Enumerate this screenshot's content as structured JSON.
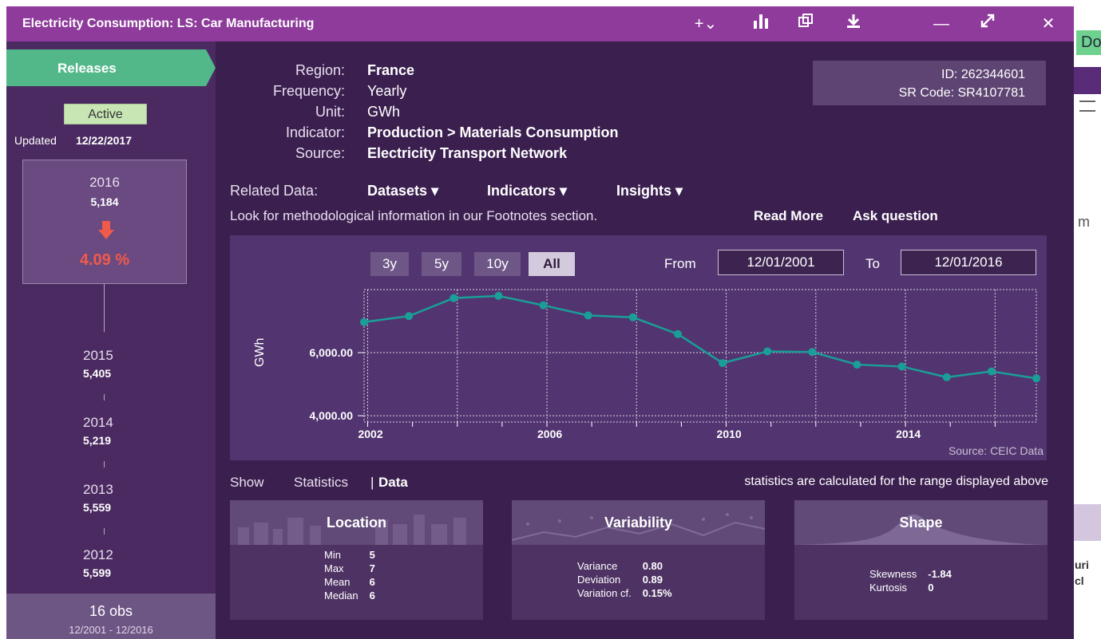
{
  "window": {
    "title": "Electricity Consumption: LS: Car Manufacturing",
    "buttons": {
      "add": "+⌄",
      "chart": "chart-icon",
      "copy": "copy-icon",
      "download": "download-icon",
      "minimize": "—",
      "maximize": "expand-icon",
      "close": "✕"
    }
  },
  "background": {
    "fragments": [
      "Do",
      "m",
      "uri",
      "cl"
    ]
  },
  "sidebar": {
    "tab_label": "Releases",
    "status": "Active",
    "updated_label": "Updated",
    "updated_date": "12/22/2017",
    "current": {
      "year": "2016",
      "value": "5,184",
      "change": "4.09 %"
    },
    "releases": [
      {
        "year": "2015",
        "value": "5,405"
      },
      {
        "year": "2014",
        "value": "5,219"
      },
      {
        "year": "2013",
        "value": "5,559"
      },
      {
        "year": "2012",
        "value": "5,599"
      }
    ],
    "obs_count": "16 obs",
    "obs_range": "12/2001 - 12/2016"
  },
  "meta": {
    "rows": [
      {
        "key": "Region:",
        "value": "France",
        "bold": true
      },
      {
        "key": "Frequency:",
        "value": "Yearly",
        "bold": false
      },
      {
        "key": "Unit:",
        "value": "GWh",
        "bold": false
      },
      {
        "key": "Indicator:",
        "value": "Production > Materials Consumption",
        "bold": true
      },
      {
        "key": "Source:",
        "value": "Electricity Transport Network",
        "bold": true
      }
    ],
    "id": "ID: 262344601",
    "sr_code": "SR Code: SR4107781",
    "related_label": "Related Data:",
    "related": [
      "Datasets",
      "Indicators",
      "Insights"
    ],
    "footnote": "Look for methodological information in our Footnotes section.",
    "read_more": "Read More",
    "ask": "Ask question"
  },
  "range": {
    "buttons": [
      "3y",
      "5y",
      "10y",
      "All"
    ],
    "selected": "All",
    "from_label": "From",
    "from": "12/01/2001",
    "to_label": "To",
    "to": "12/01/2016"
  },
  "chart_data": {
    "type": "line",
    "ylabel": "GWh",
    "x": [
      2002,
      2003,
      2004,
      2005,
      2006,
      2007,
      2008,
      2009,
      2010,
      2011,
      2012,
      2013,
      2014,
      2015,
      2016
    ],
    "series": [
      {
        "values": [
          6970,
          7160,
          7730,
          7800,
          7500,
          7180,
          7120,
          6590,
          5670,
          6040,
          6020,
          5620,
          5560,
          5220,
          5405,
          5184
        ]
      }
    ],
    "x_ticks": [
      "2002",
      "2006",
      "2010",
      "2014"
    ],
    "y_ticks": [
      "4,000.00",
      "6,000.00"
    ],
    "ylim": [
      3800,
      8000
    ],
    "source": "Source: CEIC Data",
    "line_color": "#1a9e98"
  },
  "show": {
    "label": "Show",
    "statistics": "Statistics",
    "sep": "|",
    "data": "Data",
    "note": "statistics are calculated for the range displayed above"
  },
  "stats": {
    "location": {
      "title": "Location",
      "rows": [
        [
          "Min",
          "5"
        ],
        [
          "Max",
          "7"
        ],
        [
          "Mean",
          "6"
        ],
        [
          "Median",
          "6"
        ]
      ]
    },
    "variability": {
      "title": "Variability",
      "rows": [
        [
          "Variance",
          "0.80"
        ],
        [
          "Deviation",
          "0.89"
        ],
        [
          "Variation cf.",
          "0.15%"
        ]
      ]
    },
    "shape": {
      "title": "Shape",
      "rows": [
        [
          "Skewness",
          "-1.84"
        ],
        [
          "Kurtosis",
          "0"
        ]
      ]
    }
  }
}
